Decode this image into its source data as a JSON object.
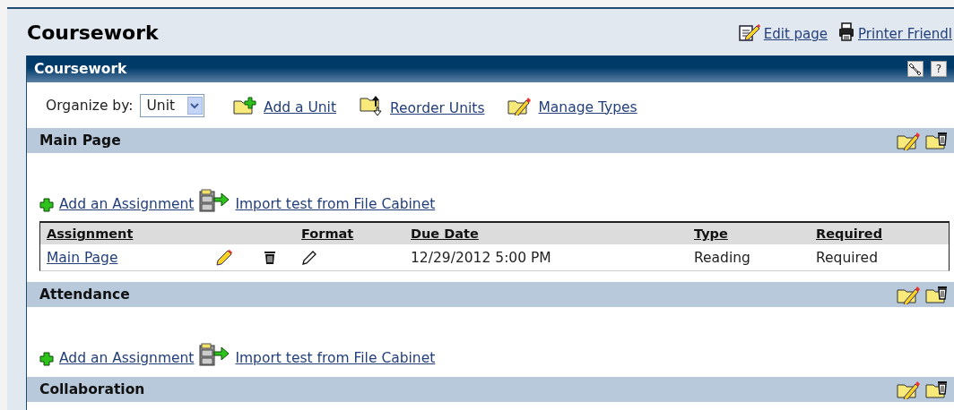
{
  "page": {
    "title": "Coursework",
    "links": [
      {
        "label": "Edit page",
        "kind": "edit"
      },
      {
        "label": "Printer Friendl",
        "kind": "print"
      }
    ]
  },
  "panel": {
    "title": "Coursework",
    "help_label": "?",
    "organize": {
      "label": "Organize by:",
      "value": "Unit"
    },
    "tools": [
      {
        "label": "Add a Unit",
        "kind": "add"
      },
      {
        "label": "Reorder Units",
        "kind": "reorder"
      },
      {
        "label": "Manage Types",
        "kind": "manage"
      }
    ],
    "units": [
      {
        "name": "Main Page",
        "actions": [
          {
            "label": "Add an Assignment",
            "kind": "add"
          },
          {
            "label": "Import test from File Cabinet",
            "kind": "import"
          }
        ],
        "table": {
          "columns": [
            "Assignment",
            "Format",
            "Due Date",
            "Type",
            "Required"
          ],
          "rows": [
            {
              "assignment": "Main Page",
              "due_date": "12/29/2012 5:00 PM",
              "type": "Reading",
              "required": "Required"
            }
          ]
        }
      },
      {
        "name": "Attendance",
        "actions": [
          {
            "label": "Add an Assignment",
            "kind": "add"
          },
          {
            "label": "Import test from File Cabinet",
            "kind": "import"
          }
        ]
      },
      {
        "name": "Collaboration"
      }
    ]
  }
}
